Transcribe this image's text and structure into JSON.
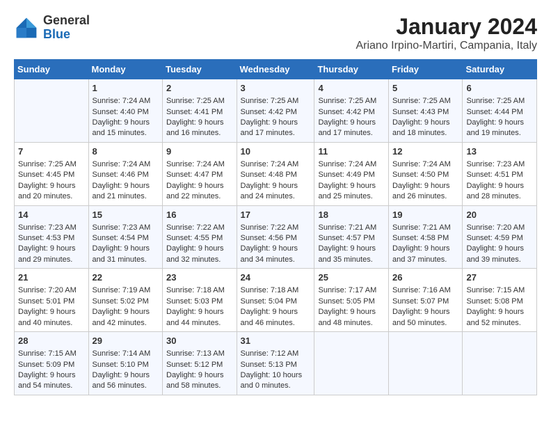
{
  "header": {
    "logo_line1": "General",
    "logo_line2": "Blue",
    "title": "January 2024",
    "subtitle": "Ariano Irpino-Martiri, Campania, Italy"
  },
  "days_of_week": [
    "Sunday",
    "Monday",
    "Tuesday",
    "Wednesday",
    "Thursday",
    "Friday",
    "Saturday"
  ],
  "weeks": [
    [
      {
        "day": "",
        "content": ""
      },
      {
        "day": "1",
        "content": "Sunrise: 7:24 AM\nSunset: 4:40 PM\nDaylight: 9 hours\nand 15 minutes."
      },
      {
        "day": "2",
        "content": "Sunrise: 7:25 AM\nSunset: 4:41 PM\nDaylight: 9 hours\nand 16 minutes."
      },
      {
        "day": "3",
        "content": "Sunrise: 7:25 AM\nSunset: 4:42 PM\nDaylight: 9 hours\nand 17 minutes."
      },
      {
        "day": "4",
        "content": "Sunrise: 7:25 AM\nSunset: 4:42 PM\nDaylight: 9 hours\nand 17 minutes."
      },
      {
        "day": "5",
        "content": "Sunrise: 7:25 AM\nSunset: 4:43 PM\nDaylight: 9 hours\nand 18 minutes."
      },
      {
        "day": "6",
        "content": "Sunrise: 7:25 AM\nSunset: 4:44 PM\nDaylight: 9 hours\nand 19 minutes."
      }
    ],
    [
      {
        "day": "7",
        "content": "Sunrise: 7:25 AM\nSunset: 4:45 PM\nDaylight: 9 hours\nand 20 minutes."
      },
      {
        "day": "8",
        "content": "Sunrise: 7:24 AM\nSunset: 4:46 PM\nDaylight: 9 hours\nand 21 minutes."
      },
      {
        "day": "9",
        "content": "Sunrise: 7:24 AM\nSunset: 4:47 PM\nDaylight: 9 hours\nand 22 minutes."
      },
      {
        "day": "10",
        "content": "Sunrise: 7:24 AM\nSunset: 4:48 PM\nDaylight: 9 hours\nand 24 minutes."
      },
      {
        "day": "11",
        "content": "Sunrise: 7:24 AM\nSunset: 4:49 PM\nDaylight: 9 hours\nand 25 minutes."
      },
      {
        "day": "12",
        "content": "Sunrise: 7:24 AM\nSunset: 4:50 PM\nDaylight: 9 hours\nand 26 minutes."
      },
      {
        "day": "13",
        "content": "Sunrise: 7:23 AM\nSunset: 4:51 PM\nDaylight: 9 hours\nand 28 minutes."
      }
    ],
    [
      {
        "day": "14",
        "content": "Sunrise: 7:23 AM\nSunset: 4:53 PM\nDaylight: 9 hours\nand 29 minutes."
      },
      {
        "day": "15",
        "content": "Sunrise: 7:23 AM\nSunset: 4:54 PM\nDaylight: 9 hours\nand 31 minutes."
      },
      {
        "day": "16",
        "content": "Sunrise: 7:22 AM\nSunset: 4:55 PM\nDaylight: 9 hours\nand 32 minutes."
      },
      {
        "day": "17",
        "content": "Sunrise: 7:22 AM\nSunset: 4:56 PM\nDaylight: 9 hours\nand 34 minutes."
      },
      {
        "day": "18",
        "content": "Sunrise: 7:21 AM\nSunset: 4:57 PM\nDaylight: 9 hours\nand 35 minutes."
      },
      {
        "day": "19",
        "content": "Sunrise: 7:21 AM\nSunset: 4:58 PM\nDaylight: 9 hours\nand 37 minutes."
      },
      {
        "day": "20",
        "content": "Sunrise: 7:20 AM\nSunset: 4:59 PM\nDaylight: 9 hours\nand 39 minutes."
      }
    ],
    [
      {
        "day": "21",
        "content": "Sunrise: 7:20 AM\nSunset: 5:01 PM\nDaylight: 9 hours\nand 40 minutes."
      },
      {
        "day": "22",
        "content": "Sunrise: 7:19 AM\nSunset: 5:02 PM\nDaylight: 9 hours\nand 42 minutes."
      },
      {
        "day": "23",
        "content": "Sunrise: 7:18 AM\nSunset: 5:03 PM\nDaylight: 9 hours\nand 44 minutes."
      },
      {
        "day": "24",
        "content": "Sunrise: 7:18 AM\nSunset: 5:04 PM\nDaylight: 9 hours\nand 46 minutes."
      },
      {
        "day": "25",
        "content": "Sunrise: 7:17 AM\nSunset: 5:05 PM\nDaylight: 9 hours\nand 48 minutes."
      },
      {
        "day": "26",
        "content": "Sunrise: 7:16 AM\nSunset: 5:07 PM\nDaylight: 9 hours\nand 50 minutes."
      },
      {
        "day": "27",
        "content": "Sunrise: 7:15 AM\nSunset: 5:08 PM\nDaylight: 9 hours\nand 52 minutes."
      }
    ],
    [
      {
        "day": "28",
        "content": "Sunrise: 7:15 AM\nSunset: 5:09 PM\nDaylight: 9 hours\nand 54 minutes."
      },
      {
        "day": "29",
        "content": "Sunrise: 7:14 AM\nSunset: 5:10 PM\nDaylight: 9 hours\nand 56 minutes."
      },
      {
        "day": "30",
        "content": "Sunrise: 7:13 AM\nSunset: 5:12 PM\nDaylight: 9 hours\nand 58 minutes."
      },
      {
        "day": "31",
        "content": "Sunrise: 7:12 AM\nSunset: 5:13 PM\nDaylight: 10 hours\nand 0 minutes."
      },
      {
        "day": "",
        "content": ""
      },
      {
        "day": "",
        "content": ""
      },
      {
        "day": "",
        "content": ""
      }
    ]
  ]
}
